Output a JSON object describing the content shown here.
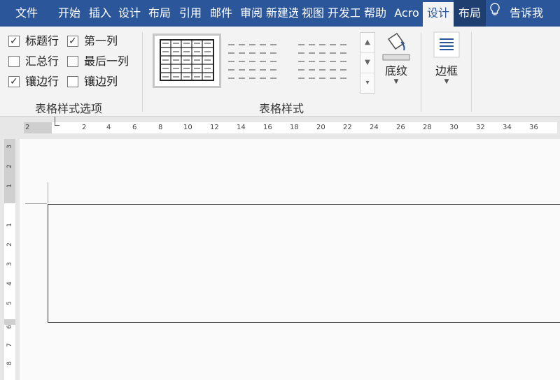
{
  "tabs": [
    {
      "label": "文件",
      "selected": false,
      "contextual": false
    },
    {
      "label": "开始",
      "selected": false,
      "contextual": false
    },
    {
      "label": "插入",
      "selected": false,
      "contextual": false
    },
    {
      "label": "设计",
      "selected": false,
      "contextual": false
    },
    {
      "label": "布局",
      "selected": false,
      "contextual": false
    },
    {
      "label": "引用",
      "selected": false,
      "contextual": false
    },
    {
      "label": "邮件",
      "selected": false,
      "contextual": false
    },
    {
      "label": "审阅",
      "selected": false,
      "contextual": false
    },
    {
      "label": "新建选",
      "selected": false,
      "contextual": false
    },
    {
      "label": "视图",
      "selected": false,
      "contextual": false
    },
    {
      "label": "开发工",
      "selected": false,
      "contextual": false
    },
    {
      "label": "帮助",
      "selected": false,
      "contextual": false
    },
    {
      "label": "Acro",
      "selected": false,
      "contextual": false
    },
    {
      "label": "设计",
      "selected": true,
      "contextual": true
    },
    {
      "label": "布局",
      "selected": false,
      "contextual": true
    }
  ],
  "tell_me": "告诉我",
  "style_options": {
    "items": [
      {
        "label": "标题行",
        "checked": true
      },
      {
        "label": "第一列",
        "checked": true
      },
      {
        "label": "汇总行",
        "checked": false
      },
      {
        "label": "最后一列",
        "checked": false
      },
      {
        "label": "镶边行",
        "checked": true
      },
      {
        "label": "镶边列",
        "checked": false
      }
    ],
    "group_label": "表格样式选项"
  },
  "table_styles": {
    "group_label": "表格样式"
  },
  "shading": {
    "label": "底纹"
  },
  "borders": {
    "label": "边框"
  },
  "ruler": {
    "h_labels": [
      "2",
      "2",
      "4",
      "6",
      "8",
      "10",
      "12",
      "14",
      "16",
      "18",
      "20",
      "22",
      "24",
      "26",
      "28",
      "30",
      "32",
      "34",
      "36"
    ],
    "v_labels": [
      "3",
      "2",
      "1",
      "1",
      "2",
      "3",
      "4",
      "5",
      "6",
      "7",
      "8"
    ]
  },
  "colors": {
    "accent": "#2b579a",
    "contextual_tab": "#1e3f70"
  }
}
